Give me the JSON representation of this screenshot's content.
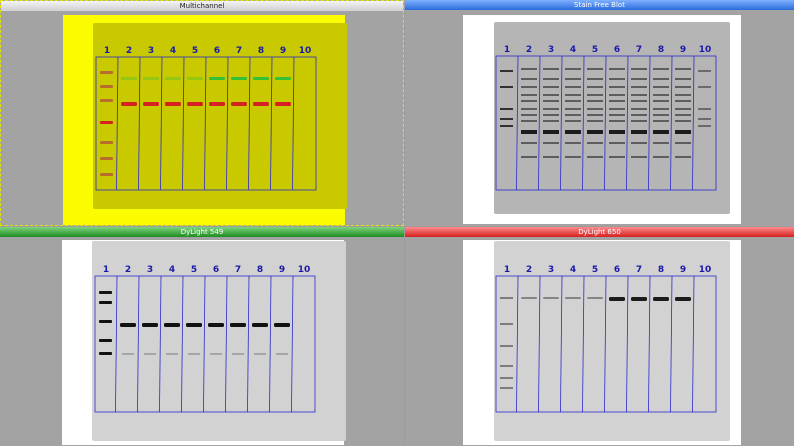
{
  "panels": {
    "multichannel": {
      "title": "Multichannel"
    },
    "stain_free": {
      "title": "Stain Free Blot"
    },
    "dylight549": {
      "title": "DyLight 549"
    },
    "dylight650": {
      "title": "DyLight 650"
    }
  },
  "lanes": [
    "1",
    "2",
    "3",
    "4",
    "5",
    "6",
    "7",
    "8",
    "9",
    "10"
  ],
  "colors": {
    "lane_box": "#2a2acc",
    "lane_number": "#1a1aa8",
    "multichannel_bg": "#fcfc00",
    "red_band": "#d42222",
    "green_band": "#35c035",
    "header_blue": "#2a6cdc",
    "header_green": "#1e8c1e",
    "header_red": "#d42020"
  }
}
